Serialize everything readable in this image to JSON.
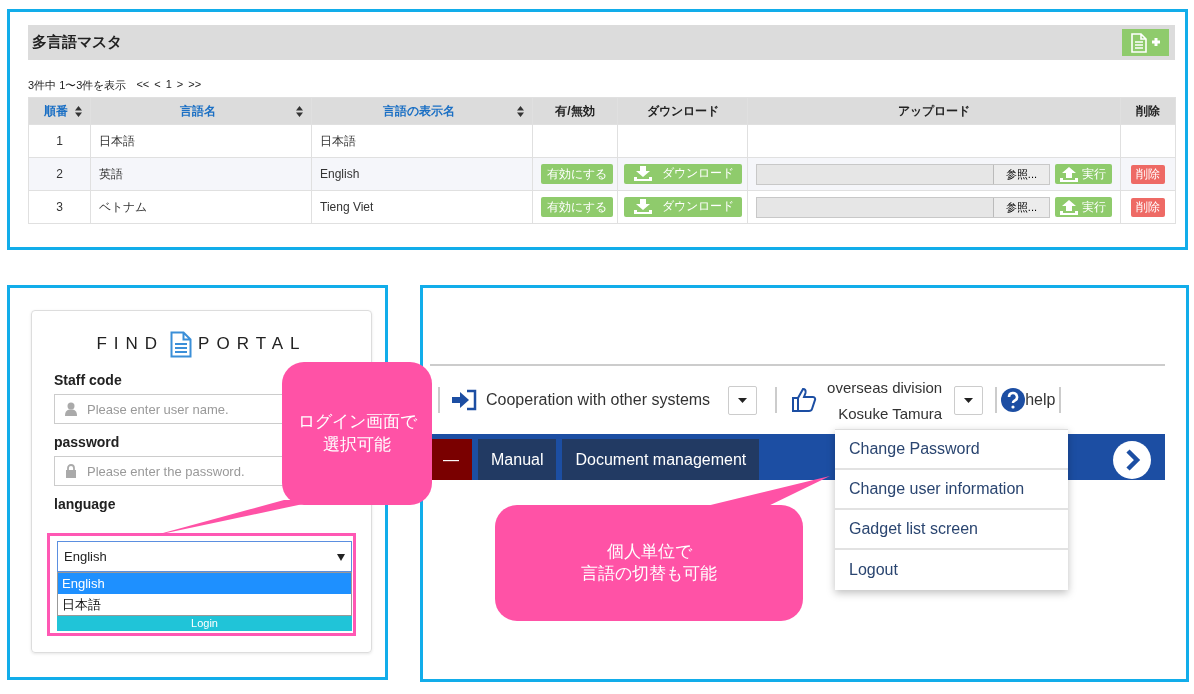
{
  "master": {
    "title": "多言語マスタ",
    "pagination": "3件中 1〜3件を表示",
    "pager": [
      "<<",
      "<",
      "1",
      ">",
      ">>"
    ],
    "columns": [
      {
        "label": "順番",
        "sortable": true
      },
      {
        "label": "言語名",
        "sortable": true
      },
      {
        "label": "言語の表示名",
        "sortable": true
      },
      {
        "label": "有/無効",
        "sortable": false
      },
      {
        "label": "ダウンロード",
        "sortable": false
      },
      {
        "label": "アップロード",
        "sortable": false
      },
      {
        "label": "削除",
        "sortable": false
      }
    ],
    "rows": [
      {
        "order": "1",
        "name": "日本語",
        "display_name": "日本語"
      },
      {
        "order": "2",
        "name": "英語",
        "display_name": "English",
        "enable_button": "有効にする",
        "download_button": "ダウンロード",
        "browse_button": "参照...",
        "run_button": "実行",
        "delete_button": "削除"
      },
      {
        "order": "3",
        "name": "ベトナム",
        "display_name": "Tieng Viet",
        "enable_button": "有効にする",
        "download_button": "ダウンロード",
        "browse_button": "参照...",
        "run_button": "実行",
        "delete_button": "削除"
      }
    ]
  },
  "login": {
    "logo_left": "FIND",
    "logo_right": "PORTAL",
    "fields": [
      {
        "label": "Staff code",
        "placeholder": "Please enter user name.",
        "kind": "user"
      },
      {
        "label": "password",
        "placeholder": "Please enter the password.",
        "kind": "lock"
      }
    ],
    "language": {
      "label": "language",
      "value": "English",
      "options": [
        {
          "label": "English",
          "selected": true
        },
        {
          "label": "日本語",
          "selected": false
        }
      ]
    },
    "login_button": "Login"
  },
  "portal": {
    "link": "Cooperation with other systems",
    "user": {
      "division": "overseas division",
      "name": "Kosuke Tamura"
    },
    "help": "help",
    "tabs": [
      {
        "label": "—",
        "kind": "home"
      },
      {
        "label": "Manual",
        "kind": "plain"
      },
      {
        "label": "Document management",
        "kind": "plain"
      }
    ],
    "user_menu": [
      "Change Password",
      "Change user information",
      "Gadget list screen",
      "Logout"
    ]
  },
  "callouts": [
    {
      "lines": [
        "ログイン画面で",
        "選択可能"
      ]
    },
    {
      "lines": [
        "個人単位で",
        "言語の切替も可能"
      ]
    }
  ]
}
